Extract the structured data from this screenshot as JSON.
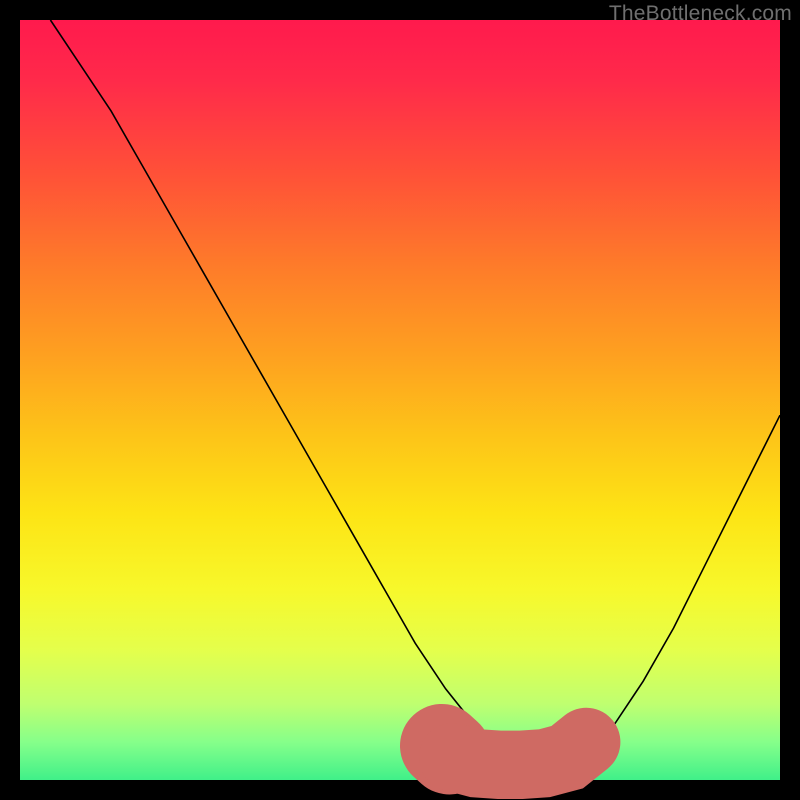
{
  "watermark": "TheBottleneck.com",
  "chart_data": {
    "type": "line",
    "title": "",
    "xlabel": "",
    "ylabel": "",
    "xlim": [
      0,
      100
    ],
    "ylim": [
      0,
      100
    ],
    "grid": false,
    "series": [
      {
        "name": "curve",
        "color": "#000000",
        "width": 1.6,
        "x": [
          4,
          8,
          12,
          16,
          20,
          24,
          28,
          32,
          36,
          40,
          44,
          48,
          52,
          56,
          60,
          64,
          66,
          70,
          74,
          78,
          82,
          86,
          90,
          94,
          98,
          100
        ],
        "y": [
          100,
          94,
          88,
          81,
          74,
          67,
          60,
          53,
          46,
          39,
          32,
          25,
          18,
          12,
          7,
          3,
          2,
          2,
          3,
          7,
          13,
          20,
          28,
          36,
          44,
          48
        ]
      },
      {
        "name": "highlight",
        "color": "#cf6a63",
        "width": 9,
        "linecap": "round",
        "x": [
          57,
          60,
          63,
          66,
          69,
          72,
          74.5
        ],
        "y": [
          3.0,
          2.2,
          2.0,
          2.0,
          2.2,
          3.0,
          5.0
        ]
      },
      {
        "name": "highlight-dot-left",
        "color": "#cf6a63",
        "width": 11,
        "linecap": "round",
        "x": [
          55.5,
          56.5
        ],
        "y": [
          4.5,
          3.6
        ]
      }
    ]
  }
}
